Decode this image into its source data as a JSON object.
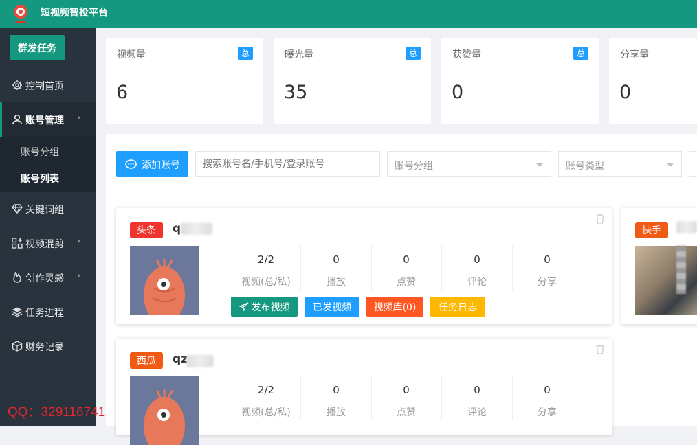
{
  "app": {
    "title": "短视频智投平台"
  },
  "sidebar": {
    "mass_task": "群发任务",
    "items": [
      {
        "label": "控制首页",
        "icon": "gear-icon"
      },
      {
        "label": "账号管理",
        "icon": "user-icon"
      },
      {
        "label": "关键词组",
        "icon": "diamond-icon"
      },
      {
        "label": "视频混剪",
        "icon": "apps-icon"
      },
      {
        "label": "创作灵感",
        "icon": "fire-icon"
      },
      {
        "label": "任务进程",
        "icon": "layers-icon"
      },
      {
        "label": "财务记录",
        "icon": "cube-icon"
      }
    ],
    "subitems": [
      "账号分组",
      "账号列表"
    ],
    "watermark": "QQ：329116741"
  },
  "stats": [
    {
      "label": "视频量",
      "badge": "总",
      "value": "6"
    },
    {
      "label": "曝光量",
      "badge": "总",
      "value": "35"
    },
    {
      "label": "获赞量",
      "badge": "总",
      "value": "0"
    },
    {
      "label": "分享量",
      "badge": "",
      "value": "0"
    }
  ],
  "toolbar": {
    "add_label": "添加账号",
    "search_placeholder": "搜索账号名/手机号/登录账号",
    "group_placeholder": "账号分组",
    "type_placeholder": "账号类型"
  },
  "metric_labels": [
    "视频(总/私)",
    "播放",
    "点赞",
    "评论",
    "分享"
  ],
  "actions": [
    "发布视频",
    "已发视频",
    "视频库(0)",
    "任务日志"
  ],
  "cards": [
    {
      "platform": "头条",
      "platform_color": "#f0352f",
      "name": "q",
      "values": [
        "2/2",
        "0",
        "0",
        "0",
        "0"
      ]
    },
    {
      "platform": "西瓜",
      "platform_color": "#f05a14",
      "name": "qz",
      "values": [
        "2/2",
        "0",
        "0",
        "0",
        "0"
      ]
    },
    {
      "platform": "快手",
      "platform_color": "#f05a14"
    }
  ],
  "colors": {
    "primary": "#14987f",
    "blue": "#1e9fff",
    "orange": "#ff5722",
    "yellow": "#ffb800",
    "sidebar": "#28333e"
  }
}
